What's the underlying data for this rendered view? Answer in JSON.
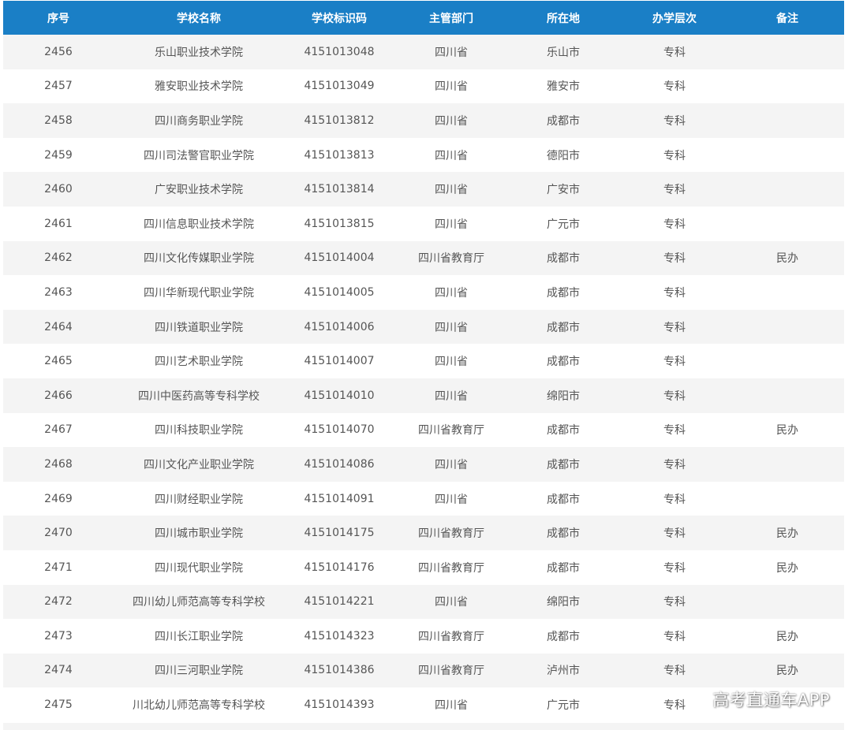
{
  "table": {
    "headers": [
      "序号",
      "学校名称",
      "学校标识码",
      "主管部门",
      "所在地",
      "办学层次",
      "备注"
    ],
    "rows": [
      [
        "2456",
        "乐山职业技术学院",
        "4151013048",
        "四川省",
        "乐山市",
        "专科",
        ""
      ],
      [
        "2457",
        "雅安职业技术学院",
        "4151013049",
        "四川省",
        "雅安市",
        "专科",
        ""
      ],
      [
        "2458",
        "四川商务职业学院",
        "4151013812",
        "四川省",
        "成都市",
        "专科",
        ""
      ],
      [
        "2459",
        "四川司法警官职业学院",
        "4151013813",
        "四川省",
        "德阳市",
        "专科",
        ""
      ],
      [
        "2460",
        "广安职业技术学院",
        "4151013814",
        "四川省",
        "广安市",
        "专科",
        ""
      ],
      [
        "2461",
        "四川信息职业技术学院",
        "4151013815",
        "四川省",
        "广元市",
        "专科",
        ""
      ],
      [
        "2462",
        "四川文化传媒职业学院",
        "4151014004",
        "四川省教育厅",
        "成都市",
        "专科",
        "民办"
      ],
      [
        "2463",
        "四川华新现代职业学院",
        "4151014005",
        "四川省",
        "成都市",
        "专科",
        ""
      ],
      [
        "2464",
        "四川铁道职业学院",
        "4151014006",
        "四川省",
        "成都市",
        "专科",
        ""
      ],
      [
        "2465",
        "四川艺术职业学院",
        "4151014007",
        "四川省",
        "成都市",
        "专科",
        ""
      ],
      [
        "2466",
        "四川中医药高等专科学校",
        "4151014010",
        "四川省",
        "绵阳市",
        "专科",
        ""
      ],
      [
        "2467",
        "四川科技职业学院",
        "4151014070",
        "四川省教育厅",
        "成都市",
        "专科",
        "民办"
      ],
      [
        "2468",
        "四川文化产业职业学院",
        "4151014086",
        "四川省",
        "成都市",
        "专科",
        ""
      ],
      [
        "2469",
        "四川财经职业学院",
        "4151014091",
        "四川省",
        "成都市",
        "专科",
        ""
      ],
      [
        "2470",
        "四川城市职业学院",
        "4151014175",
        "四川省教育厅",
        "成都市",
        "专科",
        "民办"
      ],
      [
        "2471",
        "四川现代职业学院",
        "4151014176",
        "四川省教育厅",
        "成都市",
        "专科",
        "民办"
      ],
      [
        "2472",
        "四川幼儿师范高等专科学校",
        "4151014221",
        "四川省",
        "绵阳市",
        "专科",
        ""
      ],
      [
        "2473",
        "四川长江职业学院",
        "4151014323",
        "四川省教育厅",
        "成都市",
        "专科",
        "民办"
      ],
      [
        "2474",
        "四川三河职业学院",
        "4151014386",
        "四川省教育厅",
        "泸州市",
        "专科",
        "民办"
      ],
      [
        "2475",
        "川北幼儿师范高等专科学校",
        "4151014393",
        "四川省",
        "广元市",
        "专科",
        ""
      ]
    ]
  },
  "watermark": "高考直通车APP",
  "colors": {
    "header_bg": "#1a7fc6",
    "row_alt_bg": "#f4f4f4",
    "text": "#555555"
  }
}
